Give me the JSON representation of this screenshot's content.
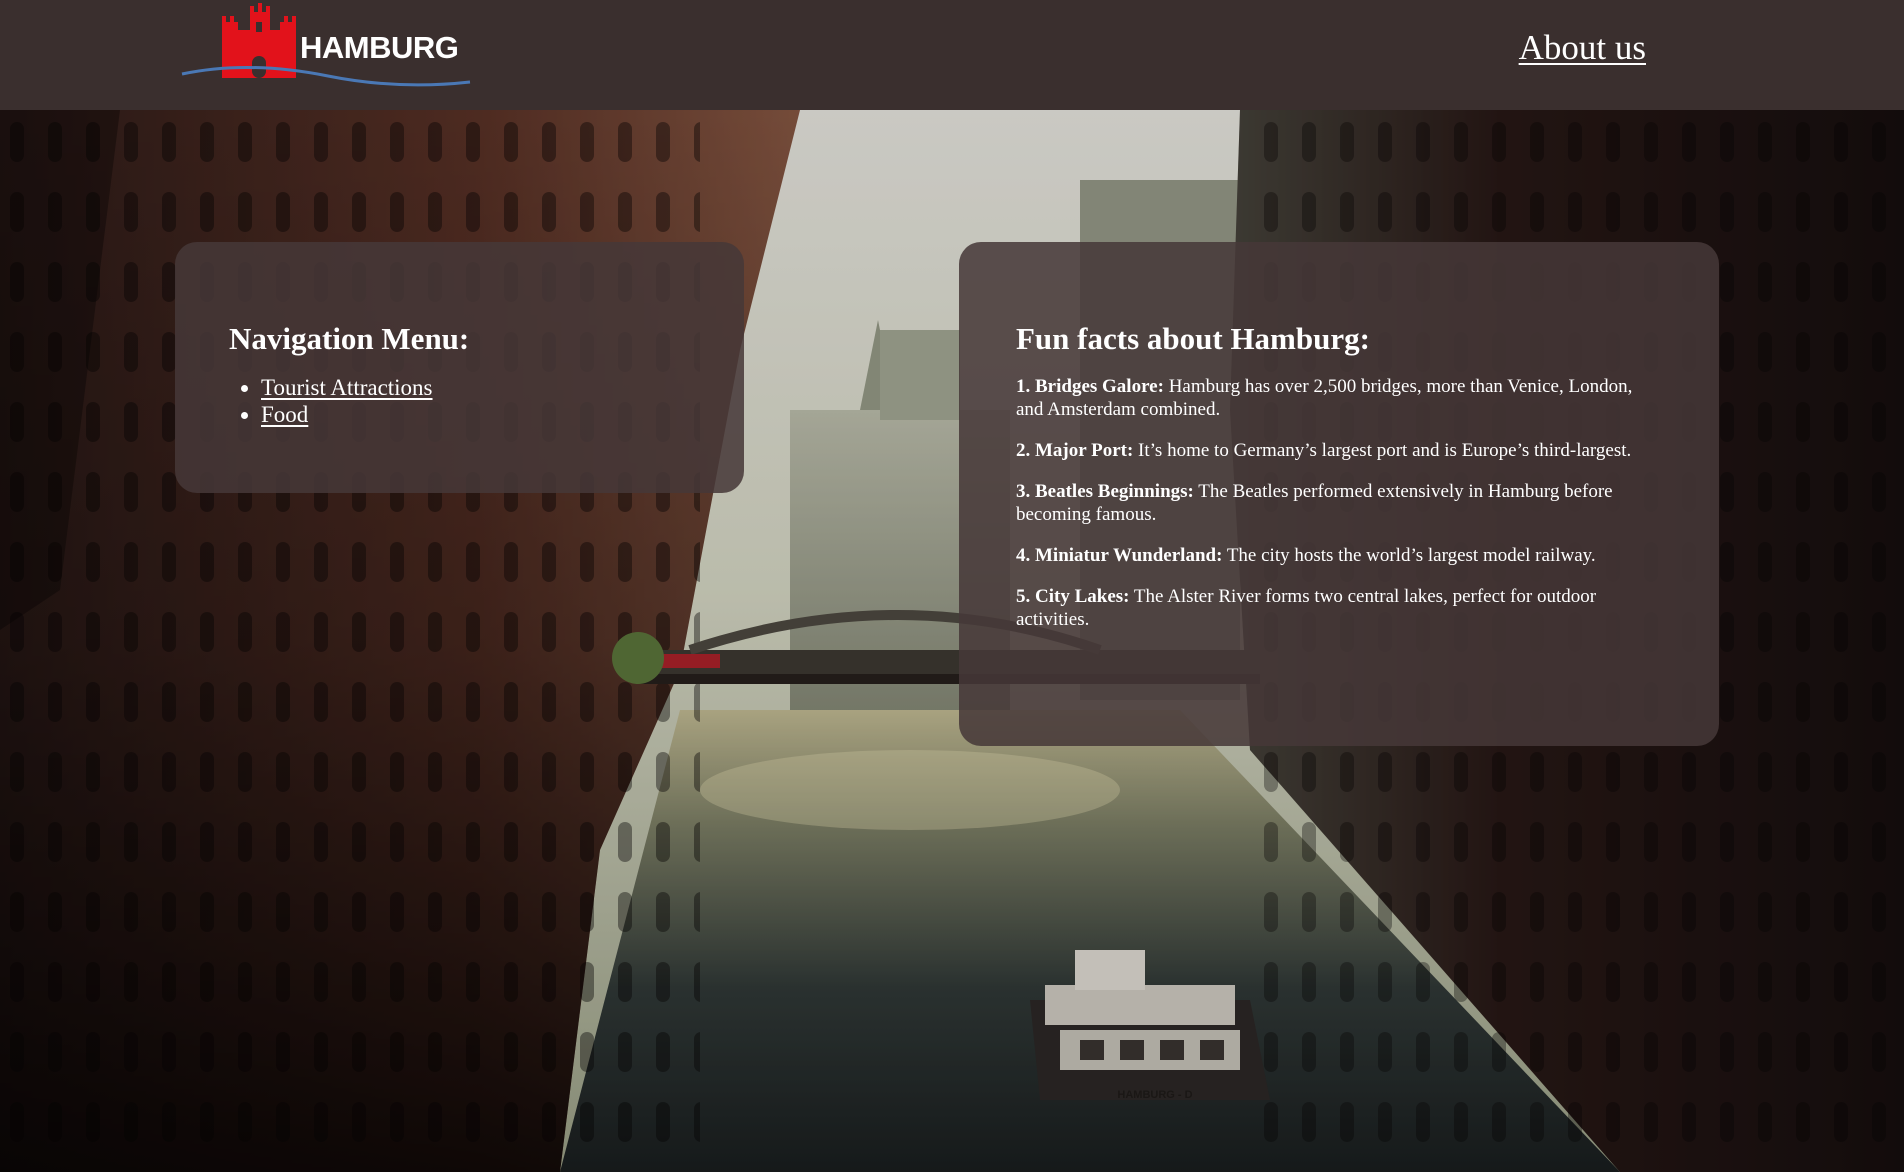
{
  "header": {
    "logo_text": "HAMBURG",
    "about_label": "About us"
  },
  "nav_panel": {
    "title": "Navigation Menu:",
    "items": [
      {
        "label": "Tourist Attractions"
      },
      {
        "label": "Food"
      }
    ]
  },
  "facts_panel": {
    "title": "Fun facts about Hamburg:",
    "facts": [
      {
        "heading": "1. Bridges Galore:",
        "text": " Hamburg has over 2,500 bridges, more than Venice, London, and Amsterdam combined."
      },
      {
        "heading": "2. Major Port:",
        "text": " It’s home to Germany’s largest port and is Europe’s third-largest."
      },
      {
        "heading": "3. Beatles Beginnings:",
        "text": " The Beatles performed extensively in Hamburg before becoming famous."
      },
      {
        "heading": "4. Miniatur Wunderland:",
        "text": " The city hosts the world’s largest model railway."
      },
      {
        "heading": "5. City Lakes:",
        "text": " The Alster River forms two central lakes, perfect for outdoor activities."
      }
    ]
  },
  "background": {
    "boat_name": "HAMBURG - D"
  },
  "colors": {
    "header_bg": "#3a2f2e",
    "panel_bg": "#463838",
    "logo_red": "#e2121b",
    "logo_wave": "#4a78b5",
    "text": "#ffffff"
  },
  "icons": {
    "logo": "hamburg-castle-logo-icon"
  }
}
